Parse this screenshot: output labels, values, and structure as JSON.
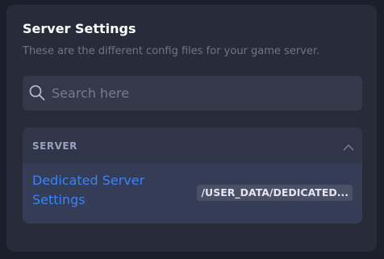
{
  "settings": {
    "title": "Server Settings",
    "subtitle": "These are the different config files for your game server."
  },
  "search": {
    "placeholder": "Search here",
    "value": ""
  },
  "sections": [
    {
      "label": "SERVER",
      "expanded": true,
      "items": [
        {
          "label": "Dedicated Server Settings",
          "path": "/USER_DATA/DEDICATED..."
        }
      ]
    }
  ],
  "icons": {
    "search": "search-icon",
    "collapse": "chevron-up-icon"
  },
  "colors": {
    "accent": "#3b82f6",
    "background": "#1c1e2b",
    "panel": "#272b3a"
  }
}
